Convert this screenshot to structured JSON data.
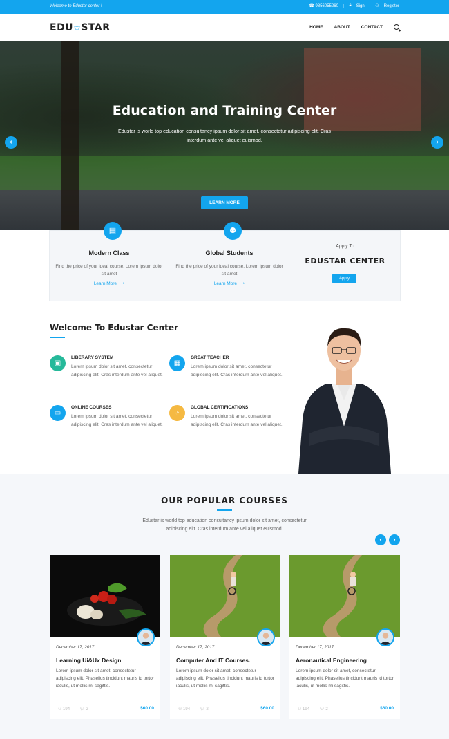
{
  "topbar": {
    "welcome": "Welcome to Edustar center !",
    "phone": "☎ 9856055260",
    "sign": "Sign",
    "register": "Register"
  },
  "header": {
    "logo_left": "EDU",
    "logo_right": "STAR",
    "nav": [
      "HOME",
      "ABOUT",
      "CONTACT"
    ]
  },
  "hero": {
    "title": "Education and Training Center",
    "text": "Edustar is world top education consultancy ipsum dolor sit amet, consectetur adipiscing elit. Cras interdum ante vel aliquet euismod.",
    "button": "LEARN MORE",
    "prev": "‹",
    "next": "›"
  },
  "features": [
    {
      "title": "Modern Class",
      "text": "Find the price of your ideal course. Lorem ipsum dolor sit amet",
      "more": "Learn More  ⟶",
      "icon": "▤"
    },
    {
      "title": "Global Students",
      "text": "Find the price of your ideal course. Lorem ipsum dolor sit amet",
      "more": "Learn More  ⟶",
      "icon": "⚉"
    }
  ],
  "apply": {
    "to": "Apply To",
    "name": "EDUSTAR CENTER",
    "button": "Apply"
  },
  "welcome": {
    "title": "Welcome To Edustar Center",
    "items": [
      {
        "title": "LIBERARY SYSTEM",
        "text": "Lorem ipsum dolor sit amet, consectetur adipiscing elit. Cras interdum ante vel aliquet.",
        "icon": "▣",
        "color": "#26b99a"
      },
      {
        "title": "GREAT TEACHER",
        "text": "Lorem ipsum dolor sit amet, consectetur adipiscing elit. Cras interdum ante vel aliquet.",
        "icon": "▦",
        "color": "#13a5ee"
      },
      {
        "title": "ONLINE COURSES",
        "text": "Lorem ipsum dolor sit amet, consectetur adipiscing elit. Cras interdum ante vel aliquet.",
        "icon": "▭",
        "color": "#13a5ee"
      },
      {
        "title": "GLOBAL CERTIFICATIONS",
        "text": "Lorem ipsum dolor sit amet, consectetur adipiscing elit. Cras interdum ante vel aliquet.",
        "icon": "◔",
        "color": "#f5b942"
      }
    ]
  },
  "courses": {
    "title": "OUR POPULAR COURSES",
    "subtitle": "Edustar is world top education consultancy ipsum dolor sit amet, consectetur adipiscing elit. Cras interdum ante vel aliquet euismod.",
    "prev": "‹",
    "next": "›",
    "items": [
      {
        "date": "December 17, 2017",
        "title": "Learning Ui&Ux Design",
        "text": "Lorem ipsum dolor sit amet, consectetur adipiscing elit. Phasellus tincidunt mauris id tortor iaculis, ut mollis mi sagittis.",
        "likes": "194",
        "comments": "2",
        "price": "$60.00"
      },
      {
        "date": "December 17, 2017",
        "title": "Computer And IT Courses.",
        "text": "Lorem ipsum dolor sit amet, consectetur adipiscing elit. Phasellus tincidunt mauris id tortor iaculis, ut mollis mi sagittis.",
        "likes": "194",
        "comments": "2",
        "price": "$60.00"
      },
      {
        "date": "December 17, 2017",
        "title": "Aeronautical Engineering",
        "text": "Lorem ipsum dolor sit amet, consectetur adipiscing elit. Phasellus tincidunt mauris id tortor iaculis, ut mollis mi sagittis.",
        "likes": "194",
        "comments": "2",
        "price": "$60.00"
      }
    ]
  },
  "colors": {
    "accent": "#13a5ee",
    "green": "#26b99a",
    "yellow": "#f5b942"
  }
}
